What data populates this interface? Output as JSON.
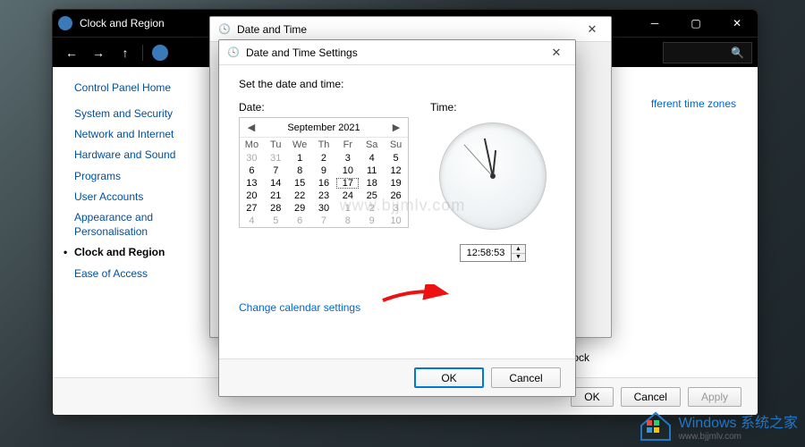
{
  "parent_window": {
    "title": "Clock and Region",
    "nav": {
      "back": "←",
      "forward": "→",
      "up": "↑"
    },
    "search_glyph": "🔍"
  },
  "sidebar": {
    "home": "Control Panel Home",
    "items": [
      {
        "label": "System and Security"
      },
      {
        "label": "Network and Internet"
      },
      {
        "label": "Hardware and Sound"
      },
      {
        "label": "Programs"
      },
      {
        "label": "User Accounts"
      },
      {
        "label": "Appearance and Personalisation"
      },
      {
        "label": "Clock and Region",
        "selected": true
      },
      {
        "label": "Ease of Access"
      }
    ]
  },
  "content": {
    "right_link_fragment": "fferent time zones",
    "peek_text_ock": "ock"
  },
  "dlg_outer": {
    "title": "Date and Time",
    "close": "✕"
  },
  "dlg_inner": {
    "title": "Date and Time Settings",
    "close": "✕",
    "instruction": "Set the date and time:",
    "date_label": "Date:",
    "time_label": "Time:",
    "time_value": "12:58:53",
    "link": "Change calendar settings",
    "ok": "OK",
    "cancel": "Cancel"
  },
  "calendar": {
    "month_label": "September 2021",
    "prev": "◀",
    "next": "▶",
    "dow": [
      "Mo",
      "Tu",
      "We",
      "Th",
      "Fr",
      "Sa",
      "Su"
    ],
    "weeks": [
      [
        {
          "n": 30,
          "out": true
        },
        {
          "n": 31,
          "out": true
        },
        {
          "n": 1
        },
        {
          "n": 2
        },
        {
          "n": 3
        },
        {
          "n": 4
        },
        {
          "n": 5
        }
      ],
      [
        {
          "n": 6
        },
        {
          "n": 7
        },
        {
          "n": 8
        },
        {
          "n": 9
        },
        {
          "n": 10
        },
        {
          "n": 11
        },
        {
          "n": 12
        }
      ],
      [
        {
          "n": 13
        },
        {
          "n": 14
        },
        {
          "n": 15
        },
        {
          "n": 16
        },
        {
          "n": 17,
          "sel": true
        },
        {
          "n": 18
        },
        {
          "n": 19
        }
      ],
      [
        {
          "n": 20
        },
        {
          "n": 21
        },
        {
          "n": 22
        },
        {
          "n": 23
        },
        {
          "n": 24
        },
        {
          "n": 25
        },
        {
          "n": 26
        }
      ],
      [
        {
          "n": 27
        },
        {
          "n": 28
        },
        {
          "n": 29
        },
        {
          "n": 30
        },
        {
          "n": 1,
          "out": true
        },
        {
          "n": 2,
          "out": true
        },
        {
          "n": 3,
          "out": true
        }
      ],
      [
        {
          "n": 4,
          "out": true
        },
        {
          "n": 5,
          "out": true
        },
        {
          "n": 6,
          "out": true
        },
        {
          "n": 7,
          "out": true
        },
        {
          "n": 8,
          "out": true
        },
        {
          "n": 9,
          "out": true
        },
        {
          "n": 10,
          "out": true
        }
      ]
    ]
  },
  "parent_footer": {
    "ok": "OK",
    "cancel": "Cancel",
    "apply": "Apply"
  },
  "watermark": {
    "center": "www.bjjmlv.com",
    "brand": "Windows 系统之家",
    "sub": "www.bjjmlv.com"
  }
}
